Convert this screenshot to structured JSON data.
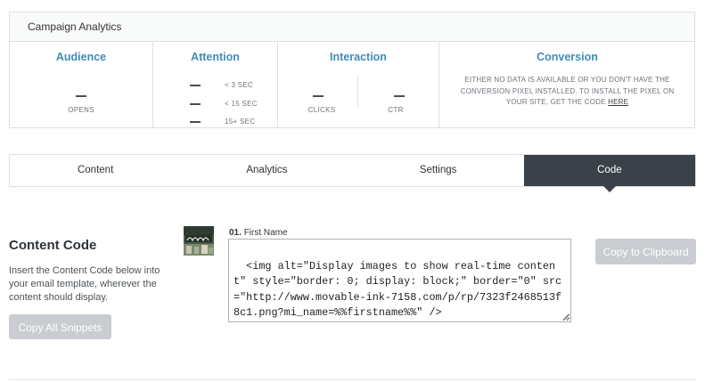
{
  "panel": {
    "title": "Campaign Analytics",
    "audience": {
      "title": "Audience",
      "value": "—",
      "label": "OPENS"
    },
    "attention": {
      "title": "Attention",
      "rows": [
        {
          "value": "—",
          "label": "< 3 SEC"
        },
        {
          "value": "—",
          "label": "< 15 SEC"
        },
        {
          "value": "—",
          "label": "15+ SEC"
        }
      ]
    },
    "interaction": {
      "title": "Interaction",
      "clicks": {
        "value": "—",
        "label": "CLICKS"
      },
      "ctr": {
        "value": "—",
        "label": "CTR"
      }
    },
    "conversion": {
      "title": "Conversion",
      "message": "EITHER NO DATA IS AVAILABLE OR YOU DON'T HAVE THE CONVERSION PIXEL INSTALLED. TO INSTALL THE PIXEL ON YOUR SITE, GET THE CODE",
      "link_label": "HERE"
    }
  },
  "tabs": [
    "Content",
    "Analytics",
    "Settings",
    "Code"
  ],
  "active_tab": "Code",
  "content_code": {
    "title": "Content Code",
    "description": "Insert the Content Code below into your email template, wherever the content should display.",
    "copy_all_label": "Copy All Snippets",
    "snippet": {
      "number": "01.",
      "name": "First Name",
      "code": "<img alt=\"Display images to show real-time content\" style=\"border: 0; display: block;\" border=\"0\" src=\"http://www.movable-ink-7158.com/p/rp/7323f2468513f8c1.png?mi_name=%%firstname%%\" />",
      "copy_label": "Copy to Clipboard"
    }
  },
  "colors": {
    "accent_blue": "#3e8cb8",
    "tab_active_bg": "#3b4148",
    "button_disabled": "#c9ccd0"
  }
}
